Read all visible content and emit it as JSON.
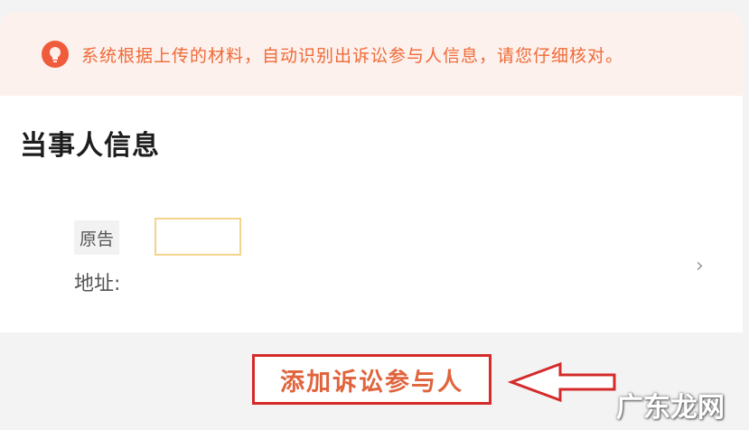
{
  "notice": {
    "icon": "lightbulb-icon",
    "text": "系统根据上传的材料，自动识别出诉讼参与人信息，请您仔细核对。"
  },
  "party_info": {
    "title": "当事人信息",
    "party_role": "原告",
    "name_value": "",
    "address_label": "地址:",
    "chevron": "›"
  },
  "actions": {
    "add_participant_label": "添加诉讼参与人"
  },
  "watermark": "广东龙网",
  "colors": {
    "accent": "#f06a36",
    "highlight_border": "#d42a2a",
    "notice_bg": "#fdf1ee"
  }
}
